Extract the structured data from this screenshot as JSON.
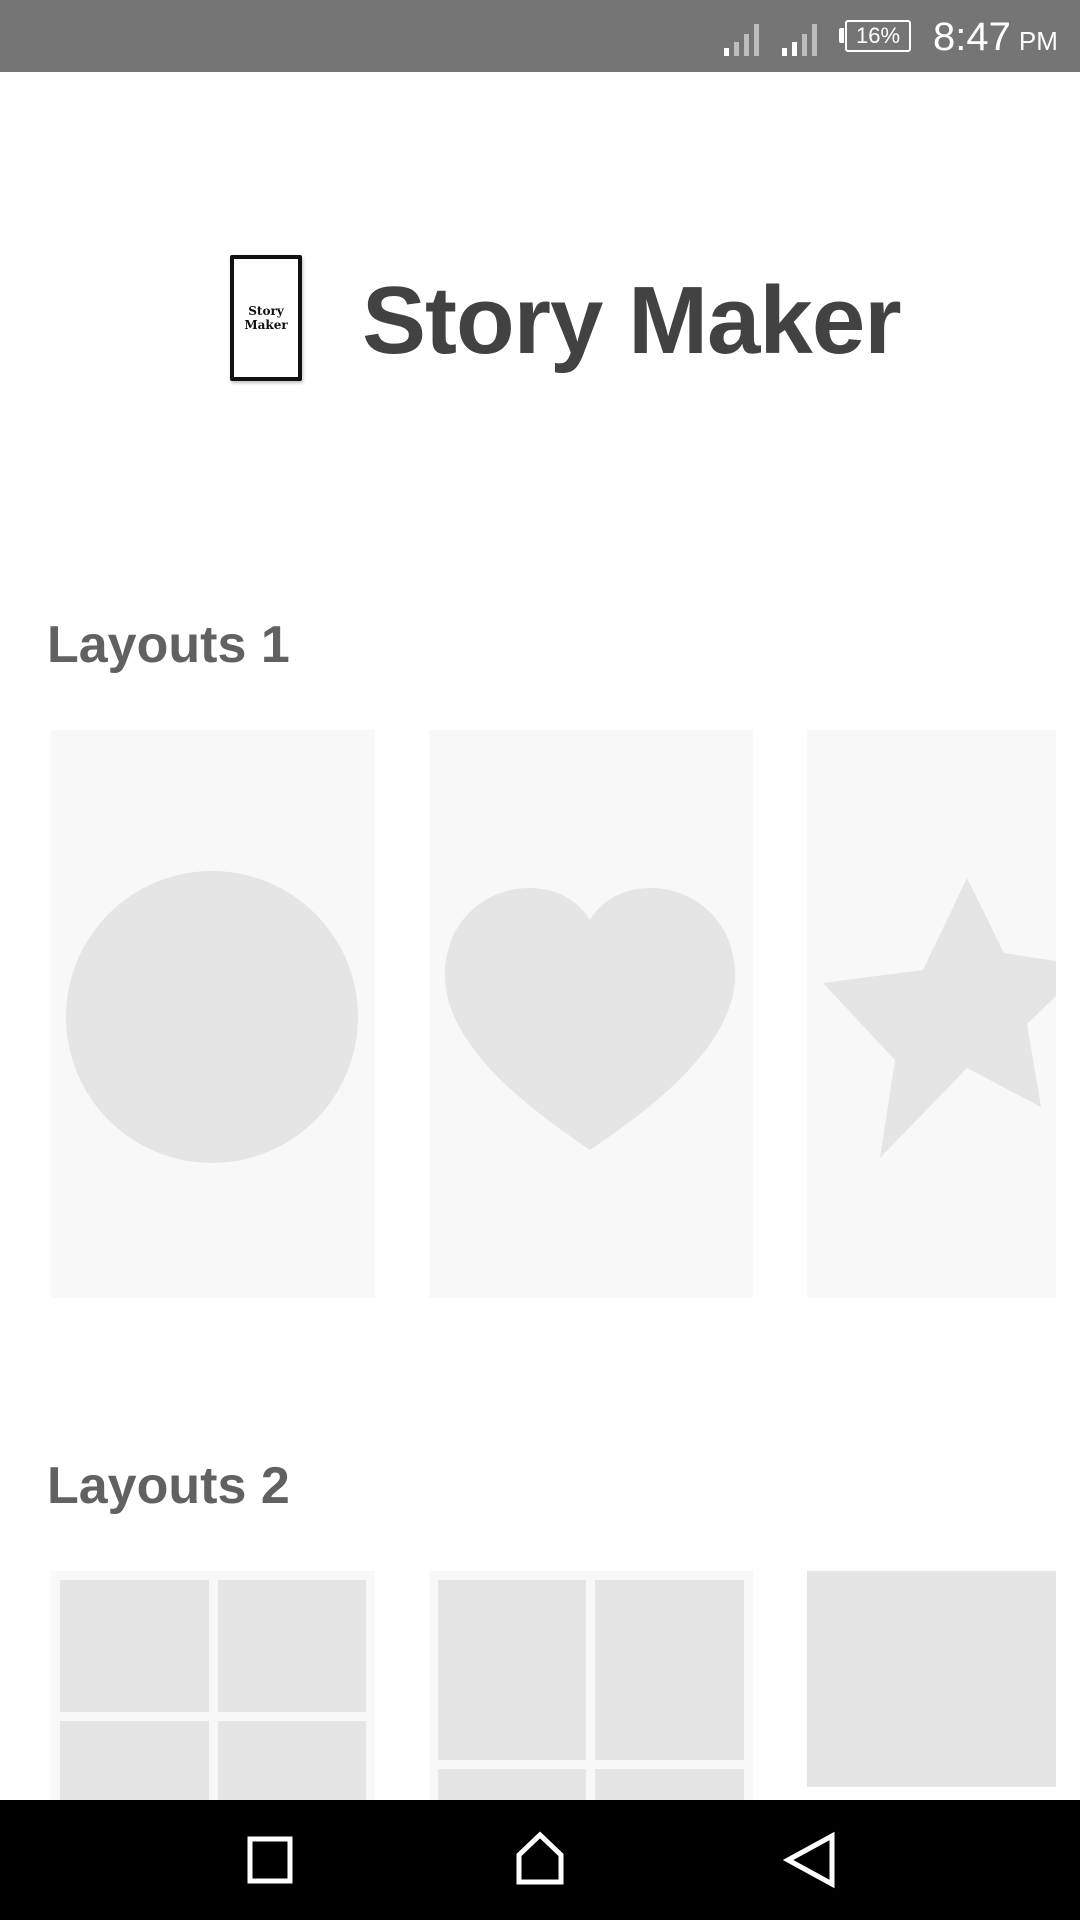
{
  "status_bar": {
    "battery_text": "16%",
    "time": "8:47",
    "ampm": "PM",
    "icons": [
      "signal-icon",
      "signal-icon",
      "battery-icon"
    ]
  },
  "header": {
    "logo_line1": "Story",
    "logo_line2": "Maker",
    "title": "Story Maker"
  },
  "sections": [
    {
      "title": "Layouts 1",
      "cards": [
        "circle-layout",
        "heart-layout",
        "star-layout"
      ]
    },
    {
      "title": "Layouts 2",
      "cards": [
        "grid-2x2-layout",
        "grid-2x2-tall-layout",
        "single-block-layout"
      ]
    }
  ],
  "colors": {
    "status_bar": "#757575",
    "card_background": "#f8f8f8",
    "shape_fill": "#e5e5e5",
    "title_text": "#424242",
    "section_text": "#616161",
    "nav_bar": "#000000"
  },
  "nav_bar": {
    "icons": [
      "recents-square-icon",
      "home-icon",
      "back-triangle-icon"
    ]
  }
}
